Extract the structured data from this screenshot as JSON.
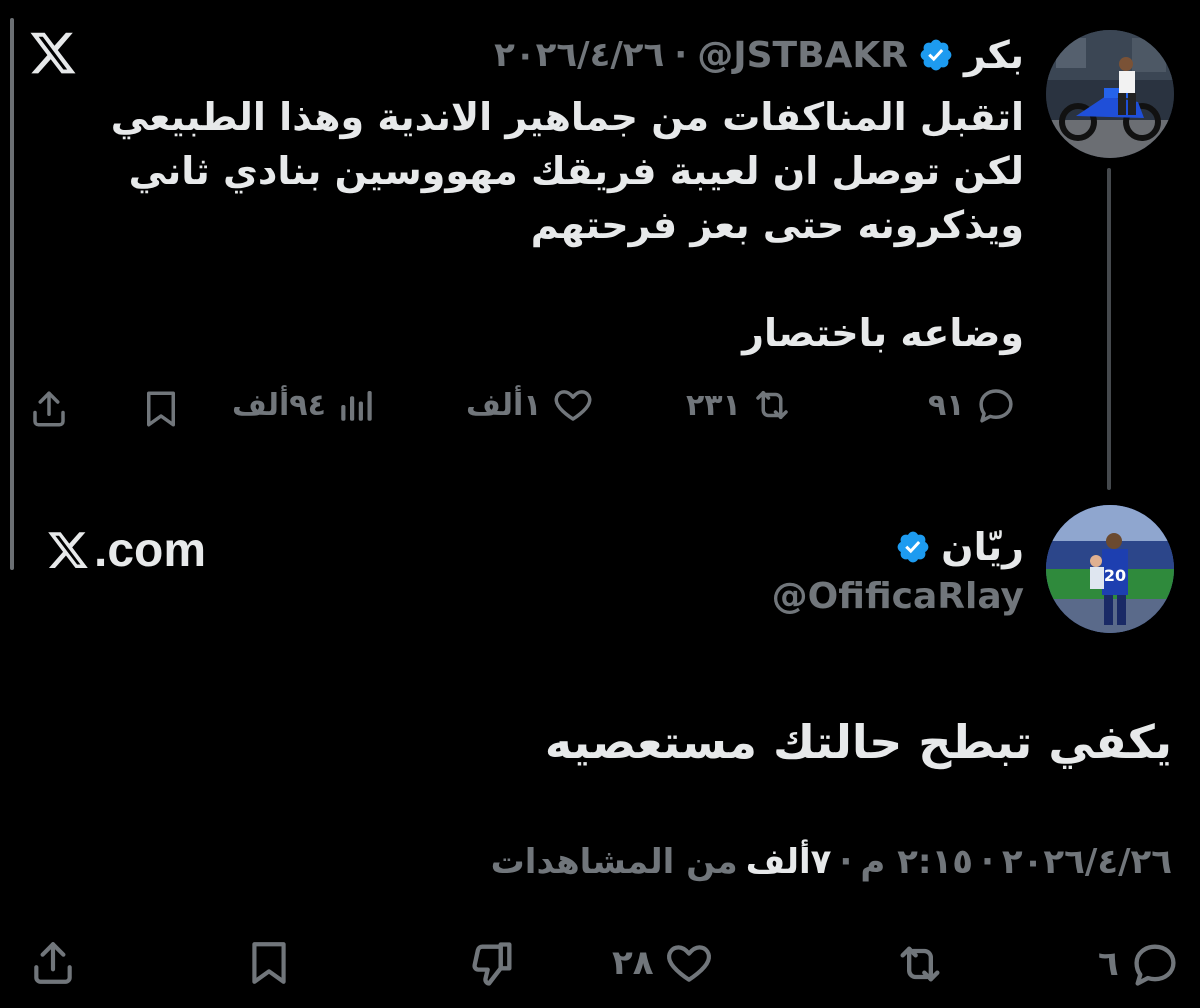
{
  "quoted_tweet": {
    "author_name": "بكر",
    "handle": "@JSTBAKR",
    "date": "٢٠٢٦/٤/٢٦",
    "separator": "·",
    "body_lines": [
      "اتقبل المناكفات من جماهير الاندية وهذا الطبيعي",
      "لكن توصل ان لعيبة فريقك مهووسين بنادي ثاني",
      "ويذكرونه حتى بعز فرحتهم"
    ],
    "body_last": "وضاعه باختصار",
    "actions": {
      "replies": "٩١",
      "reposts": "٢٣١",
      "likes": "١ألف",
      "views": "٩٤ألف"
    },
    "platform_logo": "x-logo"
  },
  "xcom_label": ".com",
  "reply_tweet": {
    "author_name": "ريّان",
    "handle": "@OfificaRlay",
    "body": "يكفي تبطح حالتك مستعصيه",
    "meta": {
      "date": "٢٠٢٦/٤/٢٦",
      "time": "٢:١٥ م",
      "separator": "·",
      "views_count": "٧ألف",
      "views_label": "من المشاهدات"
    },
    "actions": {
      "replies": "٦",
      "likes": "٢٨"
    }
  },
  "colors": {
    "background": "#000000",
    "text_primary": "#e7e9ea",
    "text_secondary": "#71767b",
    "verified_badge": "#1d9bf0"
  },
  "icons": [
    "x-logo",
    "verified-badge-icon",
    "reply-icon",
    "repost-icon",
    "like-icon",
    "views-icon",
    "bookmark-icon",
    "share-icon",
    "dislike-icon"
  ]
}
